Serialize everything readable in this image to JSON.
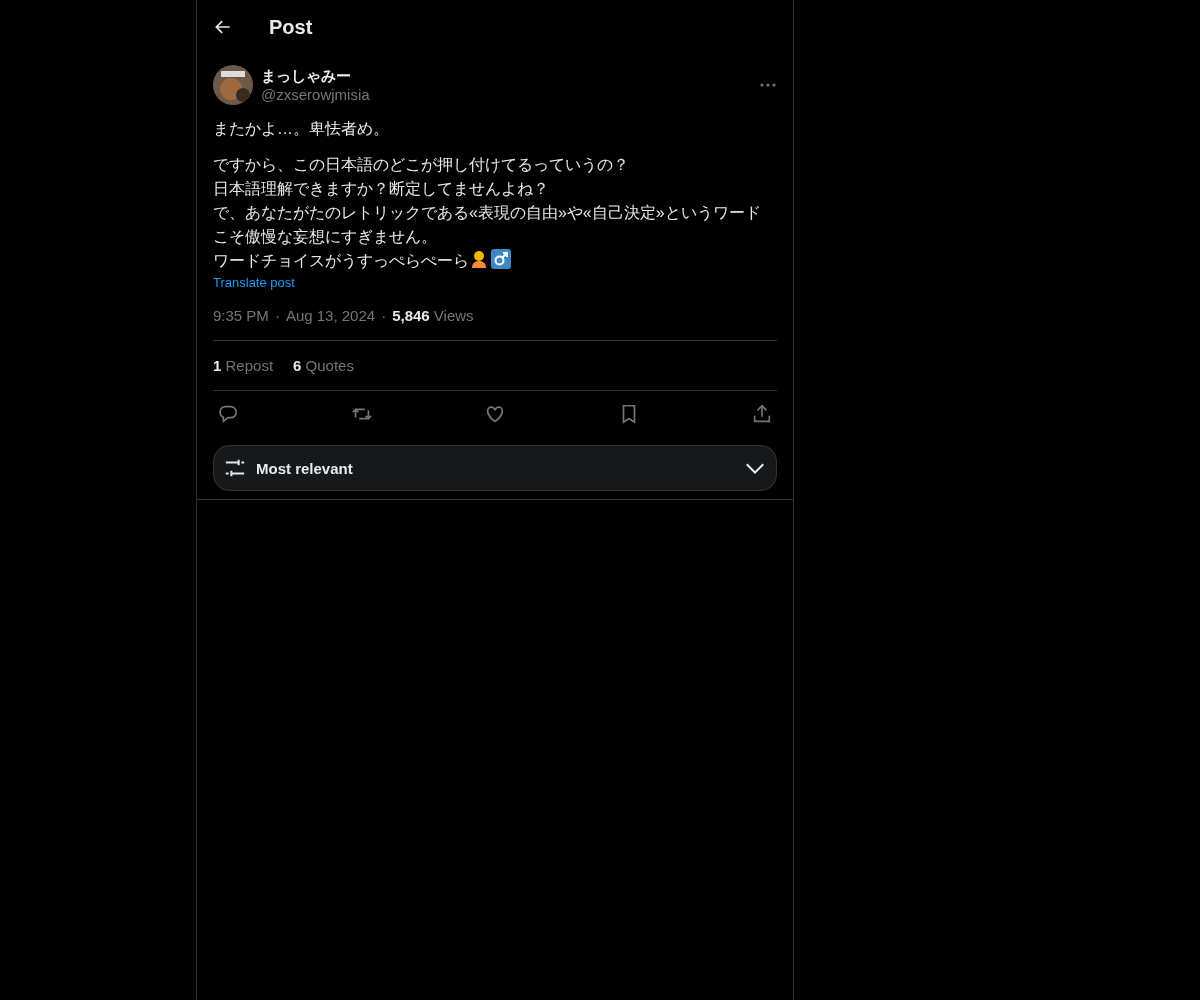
{
  "header": {
    "title": "Post"
  },
  "author": {
    "name": "まっしゃみー",
    "handle": "@zxserowjmisia"
  },
  "body": {
    "paragraphs": [
      [
        "またかよ…。卑怯者め。"
      ],
      [
        "ですから、この日本語のどこが押し付けてるっていうの？",
        "日本語理解できますか？断定してませんよね？",
        "で、あなたがたのレトリックである«表現の自由»や«自己決定»というワードこそ傲慢な妄想にすぎません。",
        "ワードチョイスがうすっぺらぺーら"
      ]
    ]
  },
  "translate_link": "Translate post",
  "meta": {
    "time": "9:35 PM",
    "separator": "·",
    "date": "Aug 13, 2024",
    "views_count": "5,846",
    "views_label": "Views"
  },
  "stats": [
    {
      "count": "1",
      "label": "Repost"
    },
    {
      "count": "6",
      "label": "Quotes"
    }
  ],
  "actions": [
    {
      "kind": "reply"
    },
    {
      "kind": "repost"
    },
    {
      "kind": "like"
    },
    {
      "kind": "bookmark"
    },
    {
      "kind": "share"
    }
  ],
  "sort": {
    "label": "Most relevant"
  }
}
